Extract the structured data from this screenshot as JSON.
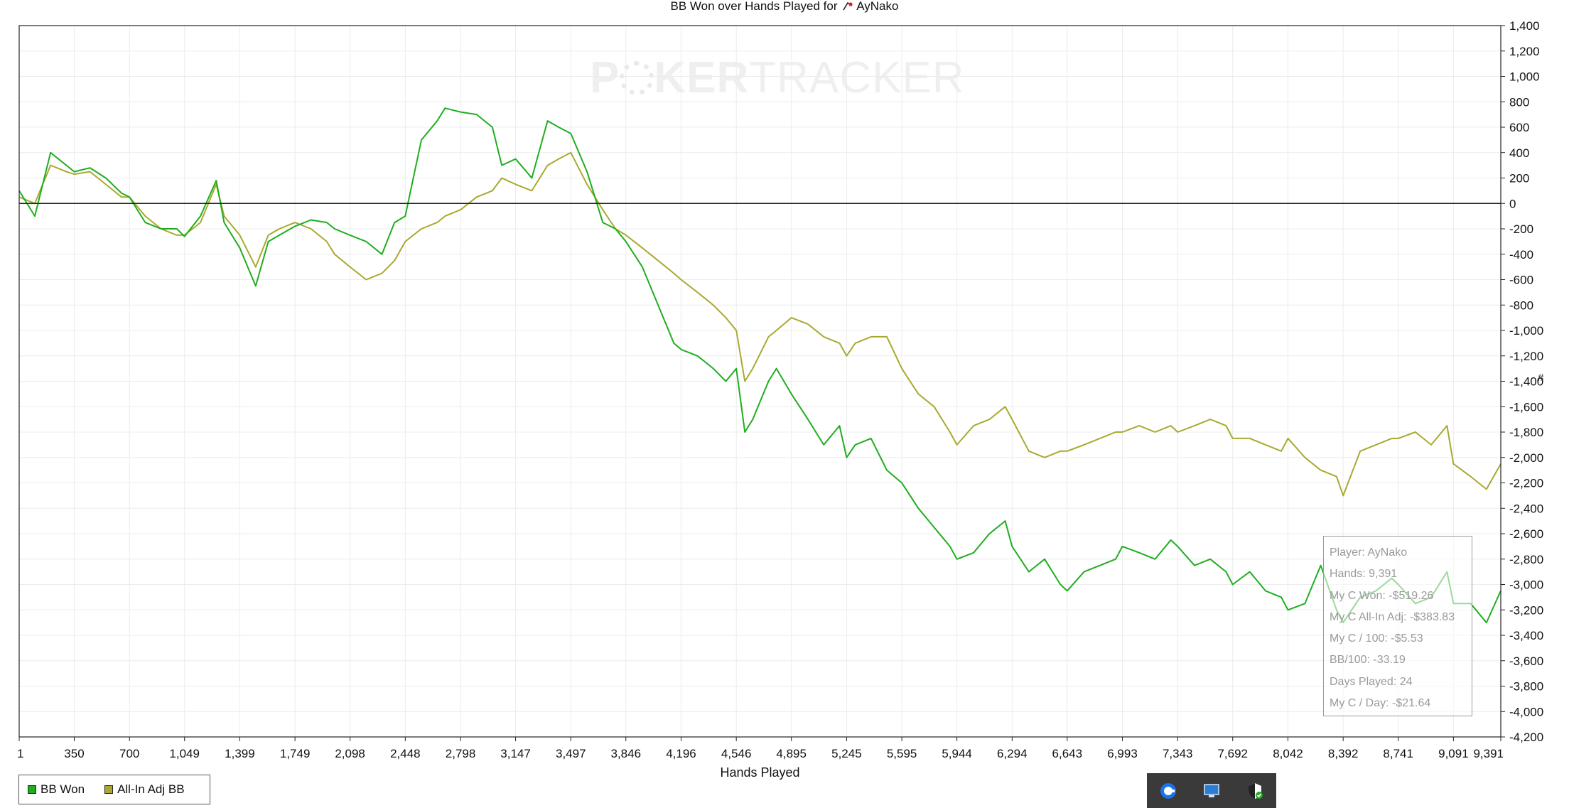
{
  "chart_data": {
    "type": "line",
    "title": "BB Won over Hands Played for",
    "player": "AyNako",
    "xlabel": "Hands Played",
    "ylabel": "",
    "xlim": [
      1,
      9391
    ],
    "ylim": [
      -4200,
      1400
    ],
    "x_ticks": [
      1,
      350,
      700,
      1049,
      1399,
      1749,
      2098,
      2448,
      2798,
      3147,
      3497,
      3846,
      4196,
      4546,
      4895,
      5245,
      5595,
      5944,
      6294,
      6643,
      6993,
      7343,
      7692,
      8042,
      8392,
      8741,
      9091,
      9391
    ],
    "x_tick_labels": [
      "1",
      "350",
      "700",
      "1,049",
      "1,399",
      "1,749",
      "2,098",
      "2,448",
      "2,798",
      "3,147",
      "3,497",
      "3,846",
      "4,196",
      "4,546",
      "4,895",
      "5,245",
      "5,595",
      "5,944",
      "6,294",
      "6,643",
      "6,993",
      "7,343",
      "7,692",
      "8,042",
      "8,392",
      "8,741",
      "9,091",
      "9,391"
    ],
    "y_ticks": [
      1400,
      1200,
      1000,
      800,
      600,
      400,
      200,
      0,
      -200,
      -400,
      -600,
      -800,
      -1000,
      -1200,
      -1400,
      -1600,
      -1800,
      -2000,
      -2200,
      -2400,
      -2600,
      -2800,
      -3000,
      -3200,
      -3400,
      -3600,
      -3800,
      -4000,
      -4200
    ],
    "y_tick_labels": [
      "1,400",
      "1,200",
      "1,000",
      "800",
      "600",
      "400",
      "200",
      "0",
      "-200",
      "-400",
      "-600",
      "-800",
      "-1,000",
      "-1,200",
      "-1,400",
      "-1,600",
      "-1,800",
      "-2,000",
      "-2,200",
      "-2,400",
      "-2,600",
      "-2,800",
      "-3,000",
      "-3,200",
      "-3,400",
      "-3,600",
      "-3,800",
      "-4,000",
      "-4,200"
    ],
    "grid": true,
    "legend_position": "bottom-left",
    "x": [
      1,
      100,
      200,
      300,
      350,
      450,
      550,
      650,
      700,
      800,
      900,
      1000,
      1049,
      1150,
      1250,
      1300,
      1399,
      1500,
      1580,
      1650,
      1749,
      1850,
      1950,
      2000,
      2098,
      2200,
      2300,
      2380,
      2448,
      2550,
      2650,
      2700,
      2798,
      2900,
      3000,
      3060,
      3147,
      3250,
      3350,
      3420,
      3497,
      3600,
      3700,
      3780,
      3846,
      3950,
      4050,
      4150,
      4196,
      4300,
      4400,
      4480,
      4546,
      4600,
      4650,
      4750,
      4800,
      4895,
      5000,
      5100,
      5200,
      5245,
      5300,
      5400,
      5500,
      5595,
      5700,
      5800,
      5900,
      5944,
      6050,
      6150,
      6250,
      6294,
      6400,
      6500,
      6600,
      6643,
      6750,
      6850,
      6950,
      6993,
      7100,
      7200,
      7300,
      7343,
      7450,
      7550,
      7650,
      7692,
      7800,
      7900,
      8000,
      8042,
      8150,
      8250,
      8350,
      8392,
      8500,
      8600,
      8700,
      8741,
      8850,
      8950,
      9050,
      9091,
      9200,
      9300,
      9391
    ],
    "series": [
      {
        "name": "BB Won",
        "color": "#1fae1f",
        "values": [
          100,
          -100,
          400,
          300,
          250,
          280,
          200,
          80,
          50,
          -150,
          -200,
          -200,
          -260,
          -100,
          180,
          -150,
          -350,
          -650,
          -300,
          -250,
          -180,
          -130,
          -150,
          -200,
          -250,
          -300,
          -400,
          -150,
          -100,
          500,
          650,
          750,
          720,
          700,
          600,
          300,
          350,
          200,
          650,
          600,
          550,
          250,
          -150,
          -200,
          -300,
          -500,
          -800,
          -1100,
          -1150,
          -1200,
          -1300,
          -1400,
          -1300,
          -1800,
          -1700,
          -1400,
          -1300,
          -1500,
          -1700,
          -1900,
          -1750,
          -2000,
          -1900,
          -1850,
          -2100,
          -2200,
          -2400,
          -2550,
          -2700,
          -2800,
          -2750,
          -2600,
          -2500,
          -2700,
          -2900,
          -2800,
          -3000,
          -3050,
          -2900,
          -2850,
          -2800,
          -2700,
          -2750,
          -2800,
          -2650,
          -2700,
          -2850,
          -2800,
          -2900,
          -3000,
          -2900,
          -3050,
          -3100,
          -3200,
          -3150,
          -2850,
          -3200,
          -3300,
          -3100,
          -3050,
          -2950,
          -3000,
          -3150,
          -3100,
          -2900,
          -3150,
          -3150,
          -3300,
          -3050
        ]
      },
      {
        "name": "All-In Adj BB",
        "color": "#a9a92f",
        "values": [
          50,
          0,
          300,
          250,
          230,
          250,
          150,
          50,
          50,
          -100,
          -200,
          -250,
          -250,
          -150,
          150,
          -100,
          -250,
          -500,
          -250,
          -200,
          -150,
          -200,
          -300,
          -400,
          -500,
          -600,
          -550,
          -450,
          -300,
          -200,
          -150,
          -100,
          -50,
          50,
          100,
          200,
          150,
          100,
          300,
          350,
          400,
          150,
          -50,
          -200,
          -250,
          -350,
          -450,
          -550,
          -600,
          -700,
          -800,
          -900,
          -1000,
          -1400,
          -1300,
          -1050,
          -1000,
          -900,
          -950,
          -1050,
          -1100,
          -1200,
          -1100,
          -1050,
          -1050,
          -1300,
          -1500,
          -1600,
          -1800,
          -1900,
          -1750,
          -1700,
          -1600,
          -1700,
          -1950,
          -2000,
          -1950,
          -1950,
          -1900,
          -1850,
          -1800,
          -1800,
          -1750,
          -1800,
          -1750,
          -1800,
          -1750,
          -1700,
          -1750,
          -1850,
          -1850,
          -1900,
          -1950,
          -1850,
          -2000,
          -2100,
          -2150,
          -2300,
          -1950,
          -1900,
          -1850,
          -1850,
          -1800,
          -1900,
          -1750,
          -2050,
          -2150,
          -2250,
          -2050
        ]
      }
    ]
  },
  "tooltip": {
    "lines": [
      "Player: AyNako",
      "Hands: 9,391",
      "My C Won: -$519.26",
      "My C All-In Adj: -$383.83",
      "My C / 100: -$5.53",
      "BB/100: -33.19",
      "Days Played: 24",
      "My C / Day: -$21.64"
    ]
  },
  "watermark": {
    "poker": "P",
    "poker_rest": "KER",
    "tracker": "TRACKER"
  },
  "legend": [
    {
      "label": "BB Won",
      "color": "#1fae1f"
    },
    {
      "label": "All-In Adj BB",
      "color": "#a9a92f"
    }
  ],
  "right_marker": "#",
  "taskbar": {
    "icons": [
      "google-icon",
      "monitor-icon",
      "shield-check-icon"
    ]
  },
  "colors": {
    "axis": "#222222",
    "grid": "#ececec",
    "zero_line": "#222222",
    "taskbar": "#3a3a3a"
  }
}
